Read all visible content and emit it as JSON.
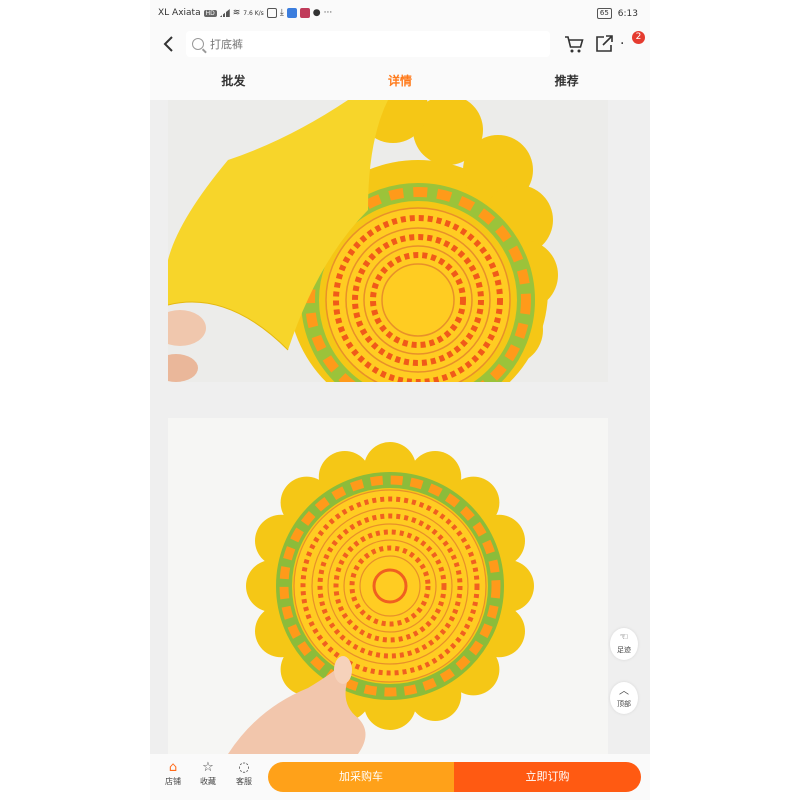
{
  "status_bar": {
    "carrier": "XL Axiata",
    "network_badge": "HD",
    "speed": "7.6 K/s",
    "battery": "65",
    "time": "6:13"
  },
  "header": {
    "search_placeholder": "打底裤",
    "cart_badge": "2"
  },
  "tabs": [
    {
      "label": "批发",
      "active": false
    },
    {
      "label": "详情",
      "active": true
    },
    {
      "label": "推荐",
      "active": false
    }
  ],
  "floating": {
    "footprint_label": "足迹",
    "top_label": "顶部"
  },
  "bottom_bar": {
    "shop_label": "店铺",
    "favorite_label": "收藏",
    "service_label": "客服",
    "add_to_cart": "加采购车",
    "buy_now": "立即订购"
  },
  "colors": {
    "accent": "#ff7a1a",
    "cart_button": "#ffa119",
    "buy_button": "#ff5a12",
    "badge": "#e53b2f"
  },
  "icons": [
    "back-icon",
    "search-icon",
    "cart-icon",
    "share-icon",
    "more-icon",
    "shop-icon",
    "star-icon",
    "chat-icon",
    "footprint-icon",
    "arrow-up-icon"
  ]
}
